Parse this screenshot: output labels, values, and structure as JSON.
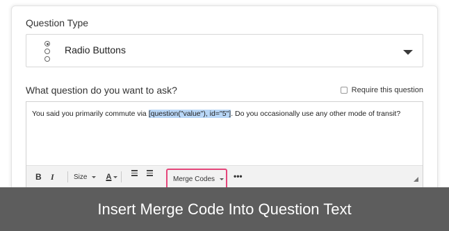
{
  "question_type": {
    "label": "Question Type",
    "selected": "Radio Buttons"
  },
  "question": {
    "label": "What question do you want to ask?",
    "require_label": "Require this question",
    "text_before": "You said you primarily commute via ",
    "merge_code": "[question(\"value\"), id=\"5\"]",
    "text_after": ". Do you occasionally use any other mode of transit?"
  },
  "toolbar": {
    "bold": "B",
    "italic": "I",
    "size": "Size",
    "color_a": "A",
    "merge_codes": "Merge Codes",
    "more": "•••"
  },
  "banner": {
    "text": "Insert Merge Code Into Question Text"
  },
  "colors": {
    "highlight": "#b9d7f7",
    "merge_border": "#e5457a",
    "banner_bg": "#5d5d5d"
  }
}
